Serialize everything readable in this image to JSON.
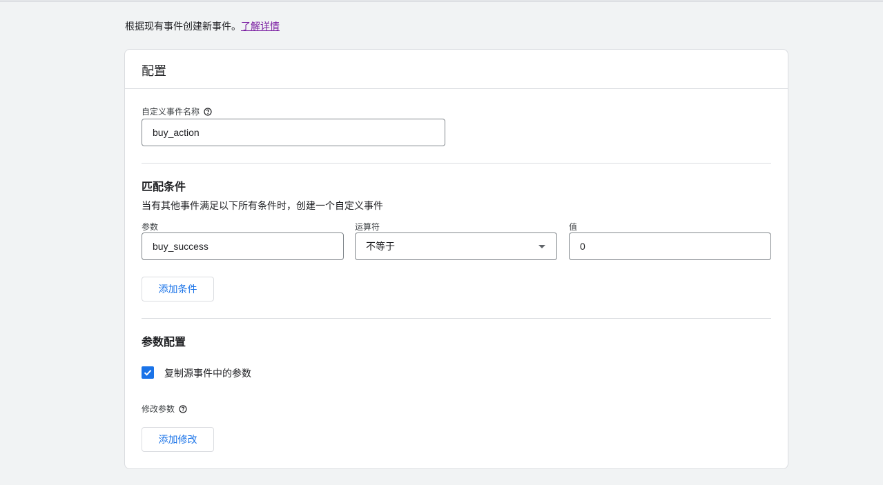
{
  "intro": {
    "text": "根据现有事件创建新事件。",
    "link": "了解详情"
  },
  "card": {
    "title": "配置",
    "custom_event": {
      "label": "自定义事件名称",
      "value": "buy_action"
    },
    "match": {
      "title": "匹配条件",
      "description": "当有其他事件满足以下所有条件时，创建一个自定义事件",
      "param_label": "参数",
      "param_value": "buy_success",
      "operator_label": "运算符",
      "operator_value": "不等于",
      "value_label": "值",
      "value_value": "0",
      "add_button": "添加条件"
    },
    "param_config": {
      "title": "参数配置",
      "copy_checkbox_label": "复制源事件中的参数",
      "copy_checked": true,
      "modify_label": "修改参数",
      "add_modify_button": "添加修改"
    }
  },
  "colors": {
    "accent": "#1a73e8",
    "link": "#7b1fa2",
    "background": "#f1f3f4"
  }
}
